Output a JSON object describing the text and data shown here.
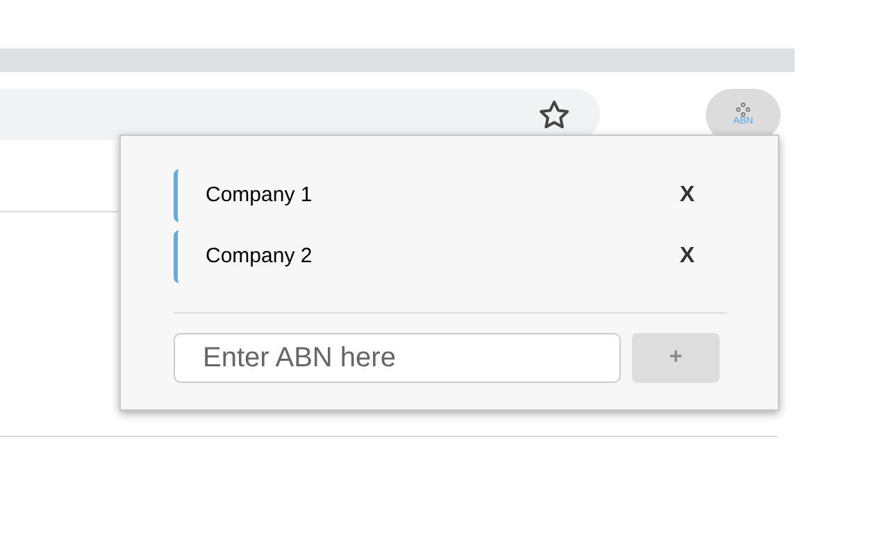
{
  "toolbar": {
    "extension_label": "ABN"
  },
  "popup": {
    "companies": [
      {
        "name": "Company 1",
        "remove": "X"
      },
      {
        "name": "Company 2",
        "remove": "X"
      }
    ],
    "abn_field": {
      "placeholder": "Enter ABN here"
    },
    "add_button": {
      "label": "+",
      "disabled": true
    }
  }
}
